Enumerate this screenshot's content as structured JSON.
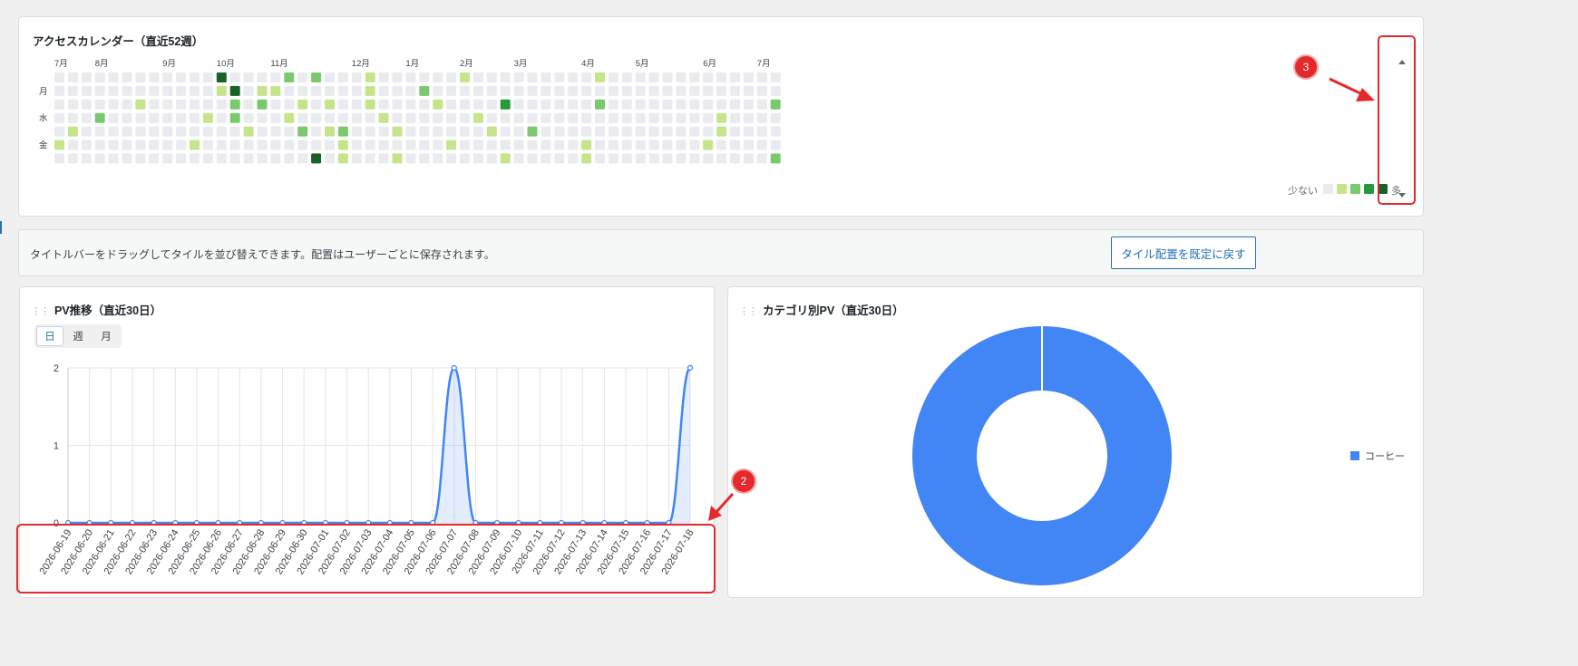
{
  "calendar": {
    "title": "アクセスカレンダー（直近52週）",
    "month_labels": [
      {
        "week": 0,
        "label": "7月"
      },
      {
        "week": 3,
        "label": "8月"
      },
      {
        "week": 8,
        "label": "9月"
      },
      {
        "week": 12,
        "label": "10月"
      },
      {
        "week": 16,
        "label": "11月"
      },
      {
        "week": 22,
        "label": "12月"
      },
      {
        "week": 26,
        "label": "1月"
      },
      {
        "week": 30,
        "label": "2月"
      },
      {
        "week": 34,
        "label": "3月"
      },
      {
        "week": 39,
        "label": "4月"
      },
      {
        "week": 43,
        "label": "5月"
      },
      {
        "week": 48,
        "label": "6月"
      },
      {
        "week": 52,
        "label": "7月"
      }
    ],
    "day_labels": [
      {
        "row": 1,
        "label": "月"
      },
      {
        "row": 3,
        "label": "水"
      },
      {
        "row": 5,
        "label": "金"
      }
    ],
    "weeks": 54,
    "cells": [
      [
        0,
        5,
        1
      ],
      [
        1,
        4,
        1
      ],
      [
        3,
        3,
        2
      ],
      [
        6,
        2,
        1
      ],
      [
        10,
        5,
        1
      ],
      [
        11,
        3,
        1
      ],
      [
        12,
        0,
        4
      ],
      [
        12,
        1,
        1
      ],
      [
        13,
        1,
        4
      ],
      [
        13,
        2,
        2
      ],
      [
        13,
        3,
        2
      ],
      [
        14,
        4,
        1
      ],
      [
        15,
        1,
        1
      ],
      [
        15,
        2,
        2
      ],
      [
        16,
        1,
        1
      ],
      [
        17,
        0,
        2
      ],
      [
        17,
        3,
        1
      ],
      [
        18,
        2,
        1
      ],
      [
        18,
        4,
        2
      ],
      [
        19,
        0,
        2
      ],
      [
        19,
        6,
        4
      ],
      [
        20,
        2,
        1
      ],
      [
        20,
        4,
        1
      ],
      [
        21,
        4,
        2
      ],
      [
        21,
        5,
        1
      ],
      [
        21,
        6,
        1
      ],
      [
        23,
        0,
        1
      ],
      [
        23,
        1,
        1
      ],
      [
        23,
        2,
        1
      ],
      [
        24,
        3,
        1
      ],
      [
        25,
        4,
        1
      ],
      [
        25,
        6,
        1
      ],
      [
        27,
        1,
        2
      ],
      [
        28,
        2,
        1
      ],
      [
        29,
        5,
        1
      ],
      [
        30,
        0,
        1
      ],
      [
        31,
        3,
        1
      ],
      [
        32,
        4,
        1
      ],
      [
        33,
        2,
        3
      ],
      [
        33,
        6,
        1
      ],
      [
        35,
        4,
        2
      ],
      [
        39,
        5,
        1
      ],
      [
        39,
        6,
        1
      ],
      [
        40,
        0,
        1
      ],
      [
        40,
        2,
        2
      ],
      [
        48,
        5,
        1
      ],
      [
        49,
        3,
        1
      ],
      [
        49,
        4,
        1
      ],
      [
        53,
        2,
        2
      ],
      [
        53,
        6,
        2
      ]
    ],
    "level_colors": [
      "#e9ebee",
      "#c6e48b",
      "#7bc96f",
      "#239a3b",
      "#196127"
    ],
    "legend_less": "少ない",
    "legend_more": "多"
  },
  "info": {
    "text": "タイトルバーをドラッグしてタイルを並び替えできます。配置はユーザーごとに保存されます。",
    "reset_button": "タイル配置を既定に戻す"
  },
  "pv": {
    "title": "PV推移（直近30日）",
    "tabs": [
      "日",
      "週",
      "月"
    ],
    "active_tab": "日"
  },
  "category": {
    "title": "カテゴリ別PV（直近30日）"
  },
  "annotations": {
    "badge_2": "2",
    "badge_3": "3"
  },
  "chart_data": [
    {
      "type": "area",
      "title": "PV推移（直近30日）",
      "xlabel": "",
      "ylabel": "",
      "x": [
        "2026-06-19",
        "2026-06-20",
        "2026-06-21",
        "2026-06-22",
        "2026-06-23",
        "2026-06-24",
        "2026-06-25",
        "2026-06-26",
        "2026-06-27",
        "2026-06-28",
        "2026-06-29",
        "2026-06-30",
        "2026-07-01",
        "2026-07-02",
        "2026-07-03",
        "2026-07-04",
        "2026-07-05",
        "2026-07-06",
        "2026-07-07",
        "2026-07-08",
        "2026-07-09",
        "2026-07-10",
        "2026-07-11",
        "2026-07-12",
        "2026-07-13",
        "2026-07-14",
        "2026-07-15",
        "2026-07-16",
        "2026-07-17",
        "2026-07-18"
      ],
      "series": [
        {
          "values": [
            0,
            0,
            0,
            0,
            0,
            0,
            0,
            0,
            0,
            0,
            0,
            0,
            0,
            0,
            0,
            0,
            0,
            0,
            2,
            0,
            0,
            0,
            0,
            0,
            0,
            0,
            0,
            0,
            0,
            2
          ]
        }
      ],
      "ylim": [
        0,
        2
      ],
      "yticks": [
        0,
        1,
        2
      ],
      "grid": true,
      "color": "#4285f4"
    },
    {
      "type": "pie",
      "title": "カテゴリ別PV（直近30日）",
      "labels": [
        "コーヒー"
      ],
      "values": [
        100
      ],
      "colors": [
        "#4285f4"
      ],
      "donut": true,
      "legend": "right"
    }
  ]
}
